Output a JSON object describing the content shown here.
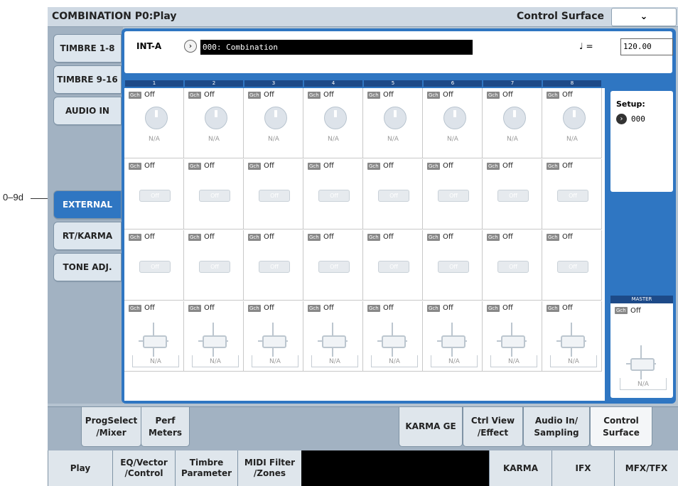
{
  "callout": {
    "label": "0–9d"
  },
  "titlebar": {
    "title": "COMBINATION P0:Play",
    "page": "Control Surface",
    "menu": "⌄"
  },
  "sidebar": {
    "tabs": [
      "TIMBRE 1-8",
      "TIMBRE 9-16",
      "AUDIO IN",
      "EXTERNAL",
      "RT/KARMA",
      "TONE ADJ."
    ],
    "active": "EXTERNAL"
  },
  "program": {
    "bank": "INT-A",
    "select_glyph": "›",
    "name": "000: Combination",
    "tempo_label": "♩ =",
    "tempo": "120.00"
  },
  "columns": [
    "1",
    "2",
    "3",
    "4",
    "5",
    "6",
    "7",
    "8"
  ],
  "cells": {
    "gch": "Gch",
    "off": "Off",
    "na": "N/A",
    "sw": "Off"
  },
  "setup": {
    "label": "Setup:",
    "value": "000",
    "glyph": "›"
  },
  "master": {
    "header": "MASTER",
    "gch": "Gch",
    "off": "Off",
    "na": "N/A"
  },
  "subtabs": [
    "ProgSelect\n/Mixer",
    "Perf\nMeters",
    "KARMA GE",
    "Ctrl View\n/Effect",
    "Audio In/\nSampling",
    "Control\nSurface"
  ],
  "maintabs": [
    "Play",
    "EQ/Vector\n/Control",
    "Timbre\nParameter",
    "MIDI Filter\n/Zones",
    "KARMA",
    "IFX",
    "MFX/TFX"
  ],
  "colors": {
    "accent": "#2f76c2",
    "header_dark": "#1d4a88",
    "frame": "#b5c3d0"
  }
}
